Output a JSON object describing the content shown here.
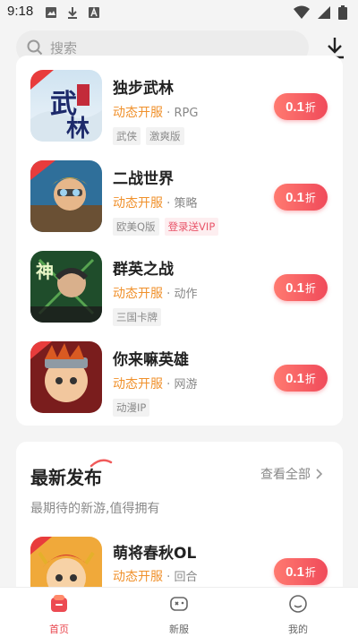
{
  "status_bar": {
    "time": "9:18"
  },
  "search": {
    "placeholder": "搜索"
  },
  "games_top": [
    {
      "name": "独步武林",
      "status": "动态开服",
      "genre": "RPG",
      "tags": [
        "武侠",
        "激爽版"
      ],
      "discount": "0.1",
      "unit": "折",
      "icon": "dubu-wulin-icon"
    },
    {
      "name": "二战世界",
      "status": "动态开服",
      "genre": "策略",
      "tags": [
        "欧美Q版",
        "登录送VIP"
      ],
      "discount": "0.1",
      "unit": "折",
      "icon": "erzhan-shijie-icon"
    },
    {
      "name": "群英之战",
      "status": "动态开服",
      "genre": "动作",
      "tags": [
        "三国卡牌"
      ],
      "discount": "0.1",
      "unit": "折",
      "icon": "qunying-zhizhan-icon"
    },
    {
      "name": "你来嘛英雄",
      "status": "动态开服",
      "genre": "网游",
      "tags": [
        "动漫IP"
      ],
      "discount": "0.1",
      "unit": "折",
      "icon": "nilaima-yingxiong-icon"
    }
  ],
  "new_release": {
    "title": "最新发布",
    "see_all": "查看全部",
    "subtitle": "最期待的新游,值得拥有",
    "games": [
      {
        "name": "萌将春秋OL",
        "status": "动态开服",
        "genre": "回合",
        "discount": "0.1",
        "unit": "折",
        "icon": "mengjiang-chunqiu-icon"
      }
    ]
  },
  "nav": [
    {
      "label": "首页",
      "active": true,
      "icon": "home-icon"
    },
    {
      "label": "新服",
      "active": false,
      "icon": "gamepad-icon"
    },
    {
      "label": "我的",
      "active": false,
      "icon": "profile-icon"
    }
  ],
  "colors": {
    "accent": "#f04a5a",
    "status": "#f0912c"
  }
}
